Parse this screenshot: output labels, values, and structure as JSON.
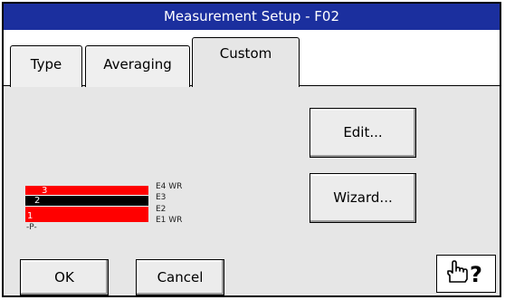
{
  "window": {
    "title": "Measurement Setup - F02"
  },
  "tabs": [
    {
      "label": "Type"
    },
    {
      "label": "Averaging"
    },
    {
      "label": "Custom"
    }
  ],
  "buttons": {
    "edit": "Edit...",
    "wizard": "Wizard...",
    "ok": "OK",
    "cancel": "Cancel"
  },
  "layer_diagram": {
    "layers": [
      {
        "number": "3",
        "color": "#ff0000"
      },
      {
        "number": "2",
        "color": "#000000"
      },
      {
        "number": "1",
        "color": "#ff0000"
      }
    ],
    "electrode_labels": [
      "E4 WR",
      "E3",
      "E2",
      "E1 WR"
    ],
    "probe_label": "-P-"
  },
  "help_icon": "pointing-hand-question-icon",
  "colors": {
    "titlebar": "#1b2f9e",
    "layer_red": "#ff0000",
    "layer_black": "#000000"
  }
}
